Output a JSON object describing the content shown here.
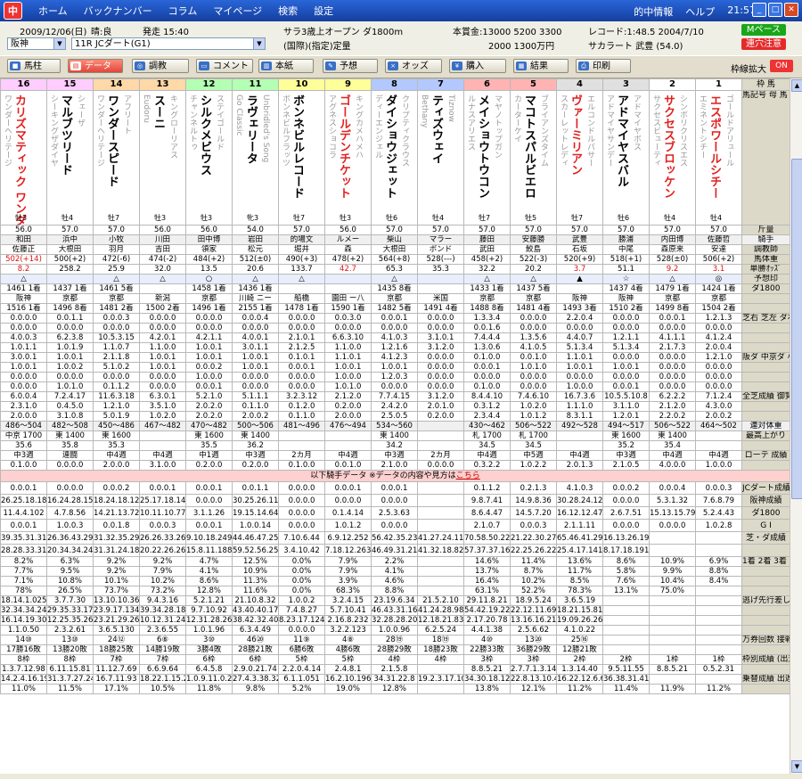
{
  "app": {
    "logo": "中",
    "menu": [
      "ホーム",
      "バックナンバー",
      "コラム",
      "マイページ",
      "検索",
      "設定"
    ],
    "right_menu": [
      "的中情報",
      "ヘルプ"
    ],
    "clock": "21:57"
  },
  "race": {
    "date": "2009/12/06(日)",
    "weather": "晴:良",
    "start": "発走 15:40",
    "venue": "阪神",
    "race_name": "11R JCダート(G1)",
    "condition1": "サラ3歳上オープン ダ1800m",
    "condition2": "(国際)(指定)定量",
    "prize_label": "本賞金:13000 5200 3300",
    "prize_label2": "2000 1300万円",
    "record": "レコード:1:48.5 2004/7/10",
    "record_horse": "サカラート 武豊 (54.0)",
    "btn_m": "Mペース",
    "btn_warn": "連穴注意"
  },
  "toolbar": {
    "buttons": [
      "馬柱",
      "データ",
      "調教",
      "コメント",
      "本紙",
      "予想",
      "オッズ",
      "購入",
      "結果",
      "印刷"
    ],
    "kakudai": "枠線拡大",
    "on": "ON"
  },
  "header": {
    "waku": [
      "8",
      "7",
      "6",
      "5",
      "4",
      "3",
      "2",
      "1"
    ],
    "nums": [
      "16",
      "15",
      "14",
      "13",
      "12",
      "11",
      "10",
      "9",
      "8",
      "7",
      "6",
      "5",
      "4",
      "3",
      "2",
      "1"
    ],
    "right_label": "枠 馬",
    "right_label2": "馬記号 母 馬 父 名",
    "right_label3": "脚質 性齢"
  },
  "horses": [
    {
      "sire": "ワンダーヘリテージ",
      "name": "カリズマティック ワンダーアキュート",
      "dam": "",
      "sex": "牡3",
      "w": "56.0",
      "j": "和田",
      "t": "佐藤正",
      "hw": "502(+14)",
      "od": "8.2",
      "red": true
    },
    {
      "sire": "シーキングザダイヤ",
      "name": "マルブツリード",
      "dam": "シェーザ",
      "sex": "牡4",
      "w": "57.0",
      "j": "浜中",
      "t": "大根田",
      "hw": "500(+2)",
      "od": "258.2",
      "red": false
    },
    {
      "sire": "ワンダーヘリテージ",
      "name": "ワンダースピード",
      "dam": "アフリート",
      "sex": "牡7",
      "w": "57.0",
      "j": "小牧",
      "t": "羽月",
      "hw": "472(-6)",
      "od": "25.9",
      "red": false
    },
    {
      "sire": "Eudoru",
      "name": "スーニ",
      "dam": "キングローリアス",
      "sex": "牡3",
      "w": "56.0",
      "j": "川田",
      "t": "吉田",
      "hw": "474(-2)",
      "od": "32.0",
      "red": false
    },
    {
      "sire": "チャンネルトゥ",
      "name": "シルクメビウス",
      "dam": "ステイゴールド",
      "sex": "牡3",
      "w": "56.0",
      "j": "田中博",
      "t": "領家",
      "hw": "484(+2)",
      "od": "13.5",
      "red": false
    },
    {
      "sire": "Go Classic",
      "name": "ラヴェリータ",
      "dam": "Unbridled's Song",
      "sex": "牝3",
      "w": "54.0",
      "j": "岩田",
      "t": "松元",
      "hw": "512(±0)",
      "od": "20.6",
      "red": false
    },
    {
      "sire": "ボンネビルフラッツ",
      "name": "ボンネビルレコード",
      "dam": "",
      "sex": "牡7",
      "w": "57.0",
      "j": "的場文",
      "t": "堀井",
      "hw": "490(+3)",
      "od": "133.7",
      "red": false
    },
    {
      "sire": "アグネスショコラ",
      "name": "ゴールデンチケット",
      "dam": "キングカメハメハ",
      "sex": "牡3",
      "w": "56.0",
      "j": "ルメー",
      "t": "森",
      "hw": "478(+2)",
      "od": "42.7",
      "red": true
    },
    {
      "sire": "ディーエンジェル",
      "name": "ダイショウジェット",
      "dam": "クリプティクラウス",
      "sex": "牡6",
      "w": "57.0",
      "j": "柴山",
      "t": "大根田",
      "hw": "564(+8)",
      "od": "65.3",
      "red": false
    },
    {
      "sire": "Bethany",
      "name": "ティズウェイ",
      "dam": "Tiznow",
      "sex": "牡4",
      "w": "57.0",
      "j": "マラー",
      "t": "ボンド",
      "hw": "528(---)",
      "od": "35.3",
      "red": false
    },
    {
      "sire": "ルナスアリエス",
      "name": "メイショウトウコン",
      "dam": "マヤノトップガン",
      "sex": "牡7",
      "w": "57.0",
      "j": "藤田",
      "t": "武田",
      "hw": "458(+2)",
      "od": "32.2",
      "red": false
    },
    {
      "sire": "カーターケイ",
      "name": "マコトスパルビエロ",
      "dam": "ブライアンズタイム",
      "sex": "牡5",
      "w": "57.0",
      "j": "安藤勝",
      "t": "鮫島",
      "hw": "522(-3)",
      "od": "20.2",
      "red": false
    },
    {
      "sire": "スカーレットレディ",
      "name": "ヴァーミリアン",
      "dam": "エルコンドルパサー",
      "sex": "牡7",
      "w": "57.0",
      "j": "武豊",
      "t": "石坂",
      "hw": "520(+9)",
      "od": "3.7",
      "red": true
    },
    {
      "sire": "アドマイヤサンデー",
      "name": "アドマイヤスバル",
      "dam": "アドマイヤボス",
      "sex": "牡6",
      "w": "57.0",
      "j": "勝浦",
      "t": "中尾",
      "hw": "518(+1)",
      "od": "51.1",
      "red": false
    },
    {
      "sire": "サクセスビューティ",
      "name": "サクセスブロッケン",
      "dam": "シンボリクリスエス",
      "sex": "牡4",
      "w": "57.0",
      "j": "内田博",
      "t": "森原来",
      "hw": "528(±0)",
      "od": "9.2",
      "red": true
    },
    {
      "sire": "エミネントシチー",
      "name": "エスポワールシチー",
      "dam": "ゴールドアリュール",
      "sex": "牡4",
      "w": "57.0",
      "j": "佐藤哲",
      "t": "安達",
      "hw": "506(+2)",
      "od": "3.1",
      "red": true
    }
  ],
  "row_labels": {
    "kinryo": "斤量",
    "jockey": "騎手",
    "trainer": "調教師",
    "hw": "馬体重",
    "odds": "単勝ｵｯｽﾞ",
    "mark": "予想印",
    "pos": "ダ1800",
    "turf": "芝右 芝左 ダ右 ダ左",
    "dam": "阪ダ 中京ダ 小ダ",
    "total": "全芝成績 御覧通算 周回通算",
    "range": "連対体重",
    "best": "最高上がり",
    "r3": "ローテ 成績",
    "jc": "JCダート成績",
    "hanshin": "阪神成績",
    "d1800": "ダ1800",
    "g1": "G I",
    "shiba": "芝・ダ成績",
    "rates": "1着 2着 3着 率",
    "mix": "逃げ先行差し追込",
    "ten": "万券回数 接戦成績",
    "waku": "枠別成績 (出遅れ)",
    "ret": "乗替成績 出遅れ率"
  },
  "marks": [
    "△",
    "",
    "△",
    "△",
    "○",
    "△",
    "△",
    "",
    "△",
    "",
    "△",
    "△",
    "▲",
    "☆",
    "△",
    "◎"
  ],
  "sep_text": "以下騎手データ ※データの内容や見方は",
  "sep_link": "こちら",
  "prev": [
    [
      "1461 1着",
      "阪神",
      "1516 1着"
    ],
    [
      "1437 1着",
      "京都",
      "1496 8着"
    ],
    [
      "1461 5着",
      "京都",
      "1481 2着"
    ],
    [
      "",
      "新潟",
      "1500 2着"
    ],
    [
      "1458 1着",
      "京都",
      "1496 1着"
    ],
    [
      "1436 1着",
      "川崎 ニー",
      "2155 1着"
    ],
    [
      "",
      "船橋",
      "1478 1着"
    ],
    [
      "",
      "園田 ー八",
      "1590 1着"
    ],
    [
      "1435 8着",
      "京都",
      "1482 5着"
    ],
    [
      "",
      "米国",
      "1491 4着"
    ],
    [
      "1433 1着",
      "京都",
      "1488 8着"
    ],
    [
      "1437 5着",
      "京都",
      "1481 4着"
    ],
    [
      "",
      "阪神",
      "1493 3着"
    ],
    [
      "1437 4着",
      "阪神",
      "1510 2着"
    ],
    [
      "1479 1着",
      "京都",
      "1499 8着"
    ],
    [
      "1424 1着",
      "京都",
      "1504 2着"
    ]
  ],
  "statA": [
    [
      "0.0.0.0",
      "0.0.1.1",
      "0.0.0.3",
      "0.0.0.0",
      "0.0.0.0",
      "0.0.0.4",
      "0.0.0.0",
      "0.0.3.0",
      "0.0.0.1",
      "0.0.0.0",
      "1.3.3.4",
      "0.0.0.0",
      "2.2.0.4",
      "0.0.0.0",
      "0.0.0.1",
      "1.2.1.3"
    ],
    [
      "0.0.0.0",
      "0.0.0.0",
      "0.0.0.0",
      "0.0.0.0",
      "0.0.0.0",
      "0.0.0.0",
      "0.0.0.0",
      "0.0.0.0",
      "0.0.0.0",
      "0.0.0.0",
      "0.0.1.6",
      "0.0.0.0",
      "0.0.0.0",
      "0.0.0.0",
      "0.0.0.0",
      "0.0.0.0"
    ],
    [
      "4.0.0.3",
      "6.2.3.8",
      "10.5.3.15",
      "4.2.0.1",
      "4.2.1.1",
      "4.0.0.1",
      "2.1.0.1",
      "6.6.3.10",
      "4.1.0.3",
      "3.1.0.1",
      "7.4.4.4",
      "1.3.5.6",
      "4.4.0.7",
      "1.2.1.1",
      "4.1.1.1",
      "4.1.2.4"
    ],
    [
      "1.0.1.1",
      "1.0.1.9",
      "1.1.0.7",
      "1.1.0.0",
      "1.0.0.1",
      "3.0.1.1",
      "2.1.2.5",
      "1.1.0.0",
      "1.2.1.6",
      "3.1.2.0",
      "1.3.0.6",
      "4.1.0.5",
      "5.1.3.4",
      "5.1.3.4",
      "2.1.7.3",
      "2.0.0.4"
    ]
  ],
  "statB": [
    [
      "3.0.0.1",
      "1.0.0.1",
      "2.1.1.8",
      "1.0.0.1",
      "1.0.0.1",
      "1.0.0.1",
      "0.1.0.1",
      "1.1.0.1",
      "4.1.2.3",
      "0.0.0.0",
      "0.1.0.0",
      "0.0.1.0",
      "1.1.0.1",
      "0.0.0.0",
      "0.0.0.0",
      "1.2.1.0"
    ],
    [
      "1.0.0.1",
      "1.0.0.2",
      "5.1.0.2",
      "1.0.0.1",
      "0.0.0.2",
      "1.0.0.1",
      "0.0.0.1",
      "1.0.0.1",
      "1.0.0.1",
      "0.0.0.0",
      "0.0.0.1",
      "1.0.1.0",
      "1.0.0.1",
      "1.0.0.1",
      "0.0.0.0",
      "0.0.0.0"
    ],
    [
      "0.0.0.0",
      "0.0.0.0",
      "0.0.0.0",
      "0.0.0.0",
      "1.0.0.0",
      "0.0.0.0",
      "0.0.0.0",
      "1.0.0.0",
      "1.2.0.3",
      "0.0.0.0",
      "0.0.0.0",
      "0.0.0.0",
      "0.0.0.0",
      "0.0.0.0",
      "0.0.0.0",
      "0.0.0.0"
    ],
    [
      "0.0.0.0",
      "1.0.1.0",
      "0.1.1.2",
      "0.0.0.0",
      "0.0.0.1",
      "0.0.0.0",
      "0.0.0.0",
      "1.0.1.0",
      "0.0.0.0",
      "0.0.0.0",
      "0.1.0.0",
      "0.0.0.0",
      "1.0.0.0",
      "0.0.0.1",
      "0.0.0.0",
      "0.0.0.0"
    ]
  ],
  "statC": [
    [
      "6.0.0.4",
      "7.2.4.17",
      "11.6.3.18",
      "6.3.0.1",
      "5.2.1.0",
      "5.1.1.1",
      "3.2.3.12",
      "2.1.2.0",
      "7.7.4.15",
      "3.1.2.0",
      "8.4.4.10",
      "7.4.6.10",
      "16.7.3.6",
      "10.5.5.10.8",
      "6.2.2.2",
      "7.1.2.4"
    ],
    [
      "2.3.1.0",
      "0.4.5.0",
      "1.2.1.0",
      "3.5.1.0",
      "2.0.2.0",
      "0.1.1.0",
      "0.1.2.0",
      "0.2.0.0",
      "2.4.2.0",
      "2.0.1.0",
      "0.3.1.2",
      "1.0.2.0",
      "1.1.1.0",
      "3.1.1.0",
      "2.1.2.0",
      "4.3.0.0"
    ],
    [
      "2.0.0.0",
      "3.1.0.8",
      "5.0.1.9",
      "1.0.2.0",
      "2.0.2.0",
      "2.0.0.2",
      "0.1.1.0",
      "2.0.0.0",
      "2.5.0.5",
      "0.2.0.0",
      "2.3.4.4",
      "1.0.1.2",
      "8.3.1.1",
      "1.2.0.1",
      "2.2.0.2",
      "2.0.0.2"
    ]
  ],
  "ranges": [
    "486〜504",
    "482〜508",
    "450〜486",
    "467〜482",
    "470〜482",
    "500〜506",
    "481〜496",
    "476〜494",
    "534〜560",
    "",
    "430〜462",
    "506〜522",
    "492〜528",
    "494〜517",
    "506〜522",
    "464〜502"
  ],
  "best": [
    [
      "中京 1700",
      "35.6"
    ],
    [
      "東 1400",
      "35.8"
    ],
    [
      "東 1600",
      "35.3"
    ],
    [
      "",
      ""
    ],
    [
      "東 1600",
      "35.5"
    ],
    [
      "東 1400",
      "36.2"
    ],
    [
      "",
      ""
    ],
    [
      "",
      ""
    ],
    [
      "東 1400",
      "34.2"
    ],
    [
      "",
      ""
    ],
    [
      "札 1700",
      "34.5"
    ],
    [
      "札 1700",
      "34.5"
    ],
    [
      "",
      ""
    ],
    [
      "東 1600",
      "35.2"
    ],
    [
      "東 1400",
      "35.4"
    ],
    [
      "",
      ""
    ]
  ],
  "rote": [
    [
      "中3週",
      "0.1.0.0"
    ],
    [
      "連闘",
      "0.0.0.0"
    ],
    [
      "中4週",
      "2.0.0.0"
    ],
    [
      "中4週",
      "3.1.0.0"
    ],
    [
      "中1週",
      "0.2.0.0"
    ],
    [
      "中3週",
      "0.2.0.0"
    ],
    [
      "2カ月",
      "0.1.0.0"
    ],
    [
      "中4週",
      "0.0.1.0"
    ],
    [
      "中3週",
      "2.1.0.0"
    ],
    [
      "2カ月",
      "0.0.0.0"
    ],
    [
      "中4週",
      "0.3.2.2"
    ],
    [
      "中5週",
      "1.0.2.2"
    ],
    [
      "中4週",
      "2.0.1.3"
    ],
    [
      "中3週",
      "2.1.0.5"
    ],
    [
      "中4週",
      "4.0.0.0"
    ],
    [
      "中4週",
      "1.0.0.0"
    ]
  ],
  "jk": [
    [
      "0.0.0.1",
      "0.0.0.0",
      "0.0.0.2",
      "0.0.0.1",
      "0.0.0.1",
      "0.0.1.1",
      "0.0.0.0",
      "0.0.0.1",
      "0.0.0.1",
      "",
      "0.1.1.2",
      "0.2.1.3",
      "4.1.0.3",
      "0.0.0.2",
      "0.0.0.4",
      "0.0.0.3"
    ],
    [
      "26.25.18.180",
      "16.24.28.157",
      "18.24.18.124",
      "25.17.18.144",
      "0.0.0.0",
      "30.25.26.111",
      "0.0.0.0",
      "0.0.0.0",
      "0.0.0.0",
      "",
      "9.8.7.41",
      "14.9.8.36",
      "30.28.24.124",
      "0.0.0.0",
      "5.3.1.32",
      "7.6.8.79"
    ],
    [
      "11.4.4.102",
      "4.7.8.56",
      "14.21.13.72",
      "10.11.10.77",
      "3.1.1.26",
      "19.15.14.64",
      "0.0.0.0",
      "0.1.4.14",
      "2.5.3.63",
      "",
      "8.6.4.47",
      "14.5.7.20",
      "16.12.12.47",
      "2.6.7.51",
      "15.13.15.79",
      "5.2.4.43"
    ],
    [
      "0.0.0.1",
      "1.0.0.3",
      "0.0.1.8",
      "0.0.0.3",
      "0.0.0.1",
      "1.0.0.14",
      "0.0.0.0",
      "1.0.1.2",
      "0.0.0.0",
      "",
      "2.1.0.7",
      "0.0.0.3",
      "2.1.1.11",
      "0.0.0.0",
      "0.0.0.0",
      "1.0.2.8"
    ],
    [
      "39.35.31.313",
      "26.36.43.292",
      "31.32.35.290",
      "26.26.33.261",
      "9.10.18.249",
      "44.46.47.259",
      "7.10.6.44",
      "6.9.12.252",
      "56.42.35.230",
      "41.27.24.118",
      "70.58.50.221",
      "21.22.30.276",
      "65.46.41.293",
      "16.13.26.195",
      "",
      ""
    ],
    [
      "28.28.33.311",
      "20.34.34.248",
      "31.31.24.188",
      "20.22.26.261",
      "15.8.11.188",
      "59.52.56.253",
      "3.4.10.42",
      "7.18.12.263",
      "46.49.31.212",
      "41.32.18.82",
      "57.37.37.165",
      "22.25.26.223",
      "25.4.17.141",
      "8.17.18.191",
      "",
      ""
    ]
  ],
  "pct": [
    [
      "8.2%",
      "6.3%",
      "9.2%",
      "9.2%",
      "4.7%",
      "12.5%",
      "0.0%",
      "7.9%",
      "2.2%",
      "",
      "14.6%",
      "11.4%",
      "13.6%",
      "8.6%",
      "10.9%",
      "6.9%"
    ],
    [
      "7.7%",
      "9.5%",
      "9.2%",
      "7.9%",
      "4.1%",
      "10.9%",
      "0.0%",
      "7.9%",
      "4.1%",
      "",
      "13.7%",
      "8.7%",
      "11.7%",
      "5.8%",
      "9.9%",
      "8.8%"
    ],
    [
      "7.1%",
      "10.8%",
      "10.1%",
      "10.2%",
      "8.6%",
      "11.3%",
      "0.0%",
      "3.9%",
      "4.6%",
      "",
      "16.4%",
      "10.2%",
      "8.5%",
      "7.6%",
      "10.4%",
      "8.4%"
    ],
    [
      "78%",
      "26.5%",
      "73.7%",
      "73.2%",
      "12.8%",
      "11.6%",
      "0.0%",
      "68.3%",
      "8.8%",
      "",
      "63.1%",
      "52.2%",
      "78.3%",
      "13.1%",
      "75.0%",
      ""
    ]
  ],
  "style": [
    [
      "18.14.1.025",
      "3.7.7.30",
      "13.10.10.36",
      "9.4.3.16",
      "5.2.1.21",
      "21.10.8.32",
      "1.0.0.2",
      "3.2.4.15",
      "23.19.6.34",
      "21.5.2.10",
      "29.11.8.21",
      "18.9.5.24",
      "3.6.5.19"
    ],
    [
      "32.34.34.249",
      "29.35.33.179",
      "23.9.17.134",
      "39.34.28.189",
      "9.7.10.92",
      "43.40.40.171",
      "7.4.8.27",
      "5.7.10.41",
      "46.43.31.164",
      "41.24.28.98",
      "54.42.19.221",
      "22.12.11.69",
      "18.21.15.81"
    ],
    [
      "16.14.19.309",
      "12.25.35.267",
      "23.21.29.268",
      "10.12.31.241",
      "12.31.28.26",
      "38.42.32.40",
      "8.23.17.124",
      "2.16.8.232",
      "32.28.28.207",
      "12.18.21.83",
      "2.17.20.78",
      "13.16.16.211",
      "19.09.26.268"
    ],
    [
      "1.1.0.50",
      "2.3.2.61",
      "3.6.5.130",
      "2.3.6.55",
      "1.0.1.96",
      "6.3.4.49",
      "0.0.0.0",
      "3.2.2.123",
      "1.0.0.96",
      "6.2.5.24",
      "4.4.1.38",
      "2.5.6.62",
      "4.1.0.22"
    ]
  ],
  "ten": [
    "14⑩",
    "13⑩",
    "24⑫",
    "6⑧",
    "3⑩",
    "46⑳",
    "11⑨",
    "4⑧",
    "28⑲",
    "18⑲",
    "4⑩",
    "13⑳",
    "25⑯"
  ],
  "ten2": [
    "17勝16敗",
    "13勝20敗",
    "18勝25敗",
    "14勝19敗",
    "3勝4敗",
    "28勝21敗",
    "6勝6敗",
    "4勝6敗",
    "28勝29敗",
    "18勝23敗",
    "22勝33敗",
    "36勝29敗",
    "12勝21敗"
  ],
  "waku_r": [
    "8枠",
    "8枠",
    "7枠",
    "7枠",
    "6枠",
    "6枠",
    "5枠",
    "5枠",
    "4枠",
    "4枠",
    "3枠",
    "3枠",
    "2枠",
    "2枠",
    "1枠",
    "1枠"
  ],
  "waku_v": [
    "1.3.7.12.98",
    "6.11.15.81",
    "11.12.7.69",
    "6.6.9.64",
    "6.4.5.8",
    "2.9.0.21.74",
    "2.2.0.4.14",
    "2.4.8.1",
    "2.1.5.8",
    "",
    "8.8.5.21",
    "2.7.7.1.3.14",
    "1.3.14.40",
    "9.5.11.55",
    "8.8.5.21",
    "0.5.2.31"
  ],
  "norikae": [
    "14.2.4.16.19.4",
    "31.3.7.27.24.1",
    "16.7.11.93",
    "18.22.1.15.22.3",
    "1.0.9.11.0.2",
    "27.4.3.38.326",
    "6.1.1.051",
    "16.2.10.196",
    "34.31.22.8",
    "19.2.3.17.10.4",
    "34.30.18.122",
    "22.8.13.10.4.0",
    "16.22.12.6.6",
    "36.38.31.416",
    "",
    ""
  ],
  "deokure": [
    "11.0%",
    "11.5%",
    "17.1%",
    "10.5%",
    "11.8%",
    "9.8%",
    "5.2%",
    "19.0%",
    "12.8%",
    "",
    "13.8%",
    "12.1%",
    "11.2%",
    "11.4%",
    "11.9%",
    "11.2%"
  ]
}
